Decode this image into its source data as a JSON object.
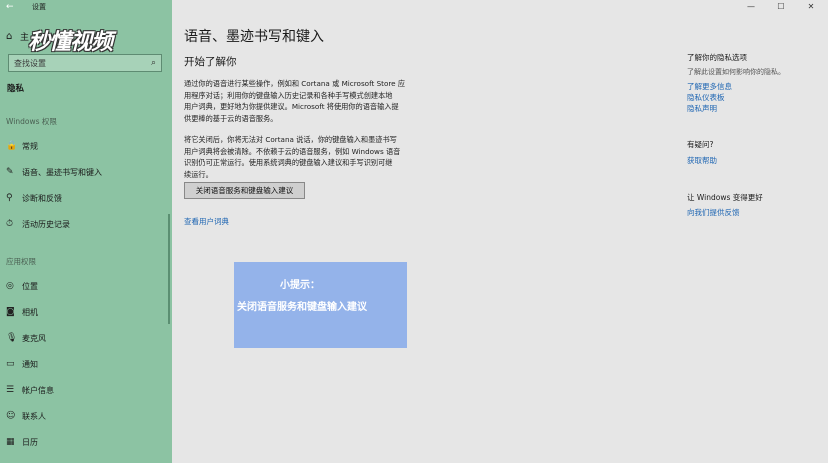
{
  "window": {
    "title": "设置",
    "back_icon": "←",
    "minimize_icon": "—",
    "maximize_icon": "☐",
    "close_icon": "✕"
  },
  "watermark": {
    "text": "秒懂视频"
  },
  "sidebar": {
    "home_icon": "⌂",
    "home_label": "主",
    "search_placeholder": "查找设置",
    "search_icon": "⌕",
    "current": "隐私",
    "group1_label": "Windows 权限",
    "group1_items": [
      {
        "icon": "🔒",
        "label": "常规"
      },
      {
        "icon": "✎",
        "label": "语音、墨迹书写和键入"
      },
      {
        "icon": "⚲",
        "label": "诊断和反馈"
      },
      {
        "icon": "⏱",
        "label": "活动历史记录"
      }
    ],
    "group2_label": "应用权限",
    "group2_items": [
      {
        "icon": "◎",
        "label": "位置"
      },
      {
        "icon": "◙",
        "label": "相机"
      },
      {
        "icon": "🎙",
        "label": "麦克风"
      },
      {
        "icon": "▭",
        "label": "通知"
      },
      {
        "icon": "☰",
        "label": "帐户信息"
      },
      {
        "icon": "☺",
        "label": "联系人"
      },
      {
        "icon": "▦",
        "label": "日历"
      }
    ]
  },
  "main": {
    "title": "语音、墨迹书写和键入",
    "section_title": "开始了解你",
    "para1": [
      "通过你的语音进行某些操作，例如和 Cortana 或 Microsoft Store 应",
      "用程序对话；利用你的键盘输入历史记录和各种手写模式创建本地",
      "用户词典，更好地为你提供建议。Microsoft 将使用你的语音输入提",
      "供更棒的基于云的语音服务。"
    ],
    "para2": [
      "将它关闭后，你将无法对 Cortana 说话，你的键盘输入和墨迹书写",
      "用户词典将会被清除。不依赖于云的语音服务，例如 Windows 语音",
      "识别仍可正常运行。使用系统词典的键盘输入建议和手写识别可继",
      "续运行。"
    ],
    "button_label": "关闭语音服务和键盘输入建议",
    "link_dictionary": "查看用户词典"
  },
  "tip": {
    "title": "小提示：",
    "body": "关闭语音服务和键盘输入建议"
  },
  "right": {
    "privacy_heading": "了解你的隐私选项",
    "privacy_text": "了解此设置如何影响你的隐私。",
    "links": [
      "了解更多信息",
      "隐私仪表板",
      "隐私声明"
    ],
    "question_heading": "有疑问?",
    "help_link": "获取帮助",
    "improve_heading": "让 Windows 变得更好",
    "feedback_link": "向我们提供反馈"
  }
}
